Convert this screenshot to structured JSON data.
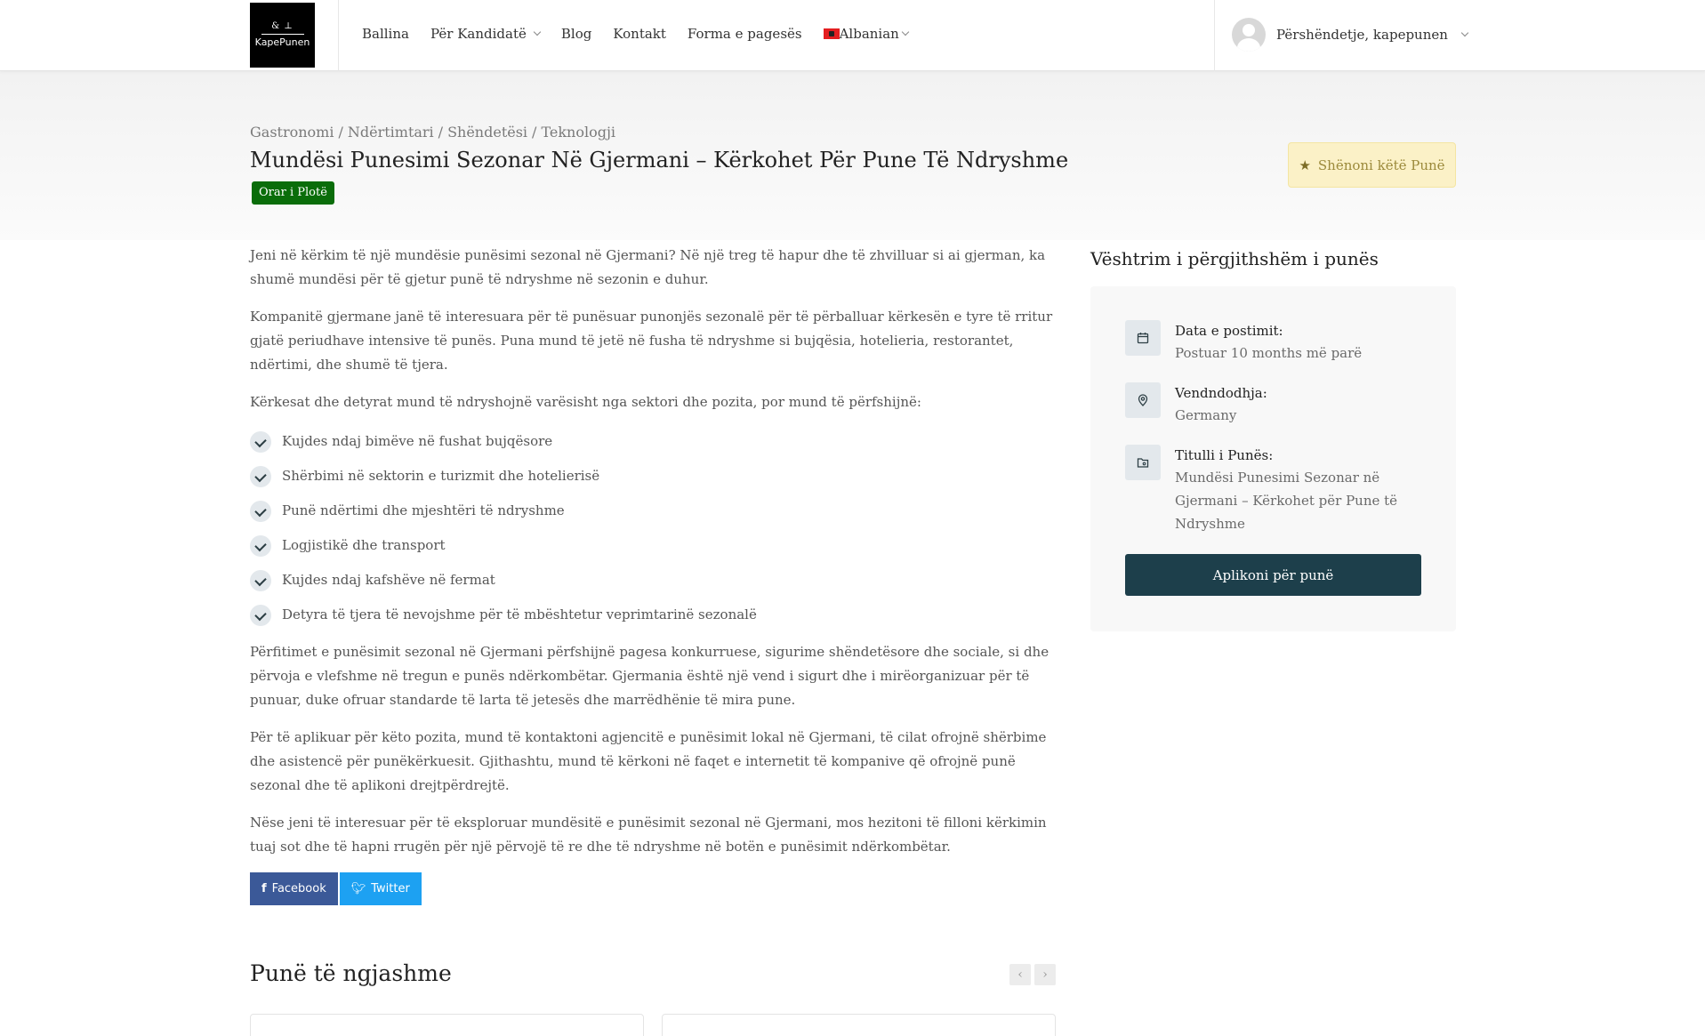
{
  "brand": {
    "logo_text": "KapePunen",
    "logo_mark": "& ⊥"
  },
  "nav": {
    "items": [
      {
        "label": "Ballina"
      },
      {
        "label": "Për Kandidatë"
      },
      {
        "label": "Blog"
      },
      {
        "label": "Kontakt"
      },
      {
        "label": "Forma e pagesës"
      },
      {
        "label": "Albanian"
      }
    ]
  },
  "user": {
    "greeting": "Përshëndetje, kapepunen"
  },
  "job": {
    "categories": [
      "Gastronomi",
      "Ndërtimtari",
      "Shëndetësi",
      "Teknologji"
    ],
    "title": "Mundësi Punesimi Sezonar Në Gjermani – Kërkohet Për Pune Të Ndryshme",
    "type": "Orar i Plotë",
    "bookmark_label": "Shënoni këtë Punë"
  },
  "content": {
    "paragraphs_before": [
      "Jeni në kërkim të një mundësie punësimi sezonal në Gjermani? Në një treg të hapur dhe të zhvilluar si ai gjerman, ka shumë mundësi për të gjetur punë të ndryshme në sezonin e duhur.",
      "Kompanitë gjermane janë të interesuara për të punësuar punonjës sezonalë për të përballuar kërkesën e tyre të rritur gjatë periudhave intensive të punës. Puna mund të jetë në fusha të ndryshme si bujqësia, hotelieria, restorantet, ndërtimi, dhe shumë të tjera.",
      "Kërkesat dhe detyrat mund të ndryshojnë varësisht nga sektori dhe pozita, por mund të përfshijnë:"
    ],
    "list": [
      "Kujdes ndaj bimëve në fushat bujqësore",
      "Shërbimi në sektorin e turizmit dhe hotelierisë",
      "Punë ndërtimi dhe mjeshtëri të ndryshme",
      "Logjistikë dhe transport",
      "Kujdes ndaj kafshëve në fermat",
      "Detyra të tjera të nevojshme për të mbështetur veprimtarinë sezonalë"
    ],
    "paragraphs_after": [
      "Përfitimet e punësimit sezonal në Gjermani përfshijnë pagesa konkurruese, sigurime shëndetësore dhe sociale, si dhe përvoja e vlefshme në tregun e punës ndërkombëtar. Gjermania është një vend i sigurt dhe i mirëorganizuar për të punuar, duke ofruar standarde të larta të jetesës dhe marrëdhënie të mira pune.",
      "Për të aplikuar për këto pozita, mund të kontaktoni agjencitë e punësimit lokal në Gjermani, të cilat ofrojnë shërbime dhe asistencë për punëkërkuesit. Gjithashtu, mund të kërkoni në faqet e internetit të kompanive që ofrojnë punë sezonal dhe të aplikoni drejtpërdrejtë.",
      "Nëse jeni të interesuar për të eksploruar mundësitë e punësimit sezonal në Gjermani, mos hezitoni të filloni kërkimin tuaj sot dhe të hapni rrugën për një përvojë të re dhe të ndryshme në botën e punësimit ndërkombëtar."
    ]
  },
  "share": {
    "facebook": "Facebook",
    "twitter": "Twitter"
  },
  "similar": {
    "title": "Punë të ngjashme",
    "prev": "‹",
    "next": "›"
  },
  "overview": {
    "title": "Vështrim i përgjithshëm i punës",
    "items": [
      {
        "label": "Data e postimit:",
        "value": "Postuar 10 months më parë",
        "icon": "calendar-icon"
      },
      {
        "label": "Vendndodhja:",
        "value": "Germany",
        "icon": "location-pin-icon"
      },
      {
        "label": "Titulli i Punës:",
        "value": "Mundësi Punesimi Sezonar në Gjermani – Kërkohet për Pune të Ndryshme",
        "icon": "folder-icon"
      }
    ],
    "apply_label": "Aplikoni për punë"
  },
  "colors": {
    "job_type_badge": "#0a6d0a",
    "bookmark_bg": "#fbf1c7",
    "apply_button": "#1d3f4b",
    "facebook": "#3b5998",
    "twitter": "#1da1f2"
  }
}
